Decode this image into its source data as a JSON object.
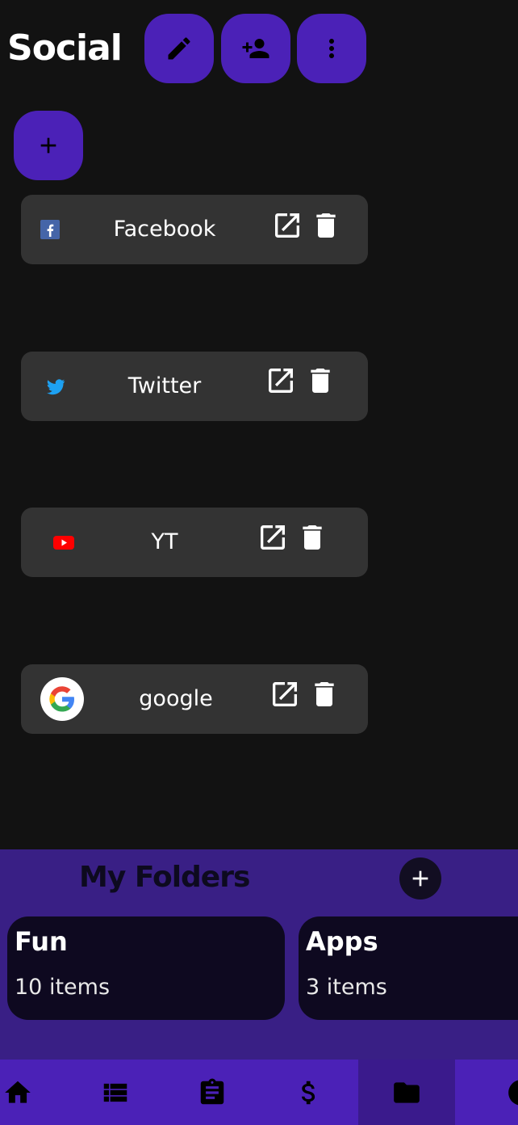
{
  "header": {
    "title": "Social",
    "buttons": [
      {
        "icon": "pencil-icon"
      },
      {
        "icon": "add-person-icon"
      },
      {
        "icon": "more-vert-icon"
      }
    ]
  },
  "add_link_button": {
    "icon": "plus-icon"
  },
  "links": [
    {
      "label": "Facebook",
      "icon": "facebook-icon"
    },
    {
      "label": "Twitter",
      "icon": "twitter-icon"
    },
    {
      "label": "YT",
      "icon": "youtube-icon"
    },
    {
      "label": "google",
      "icon": "google-icon"
    }
  ],
  "link_actions": {
    "open_icon": "open-external-icon",
    "delete_icon": "trash-icon"
  },
  "folders": {
    "title": "My Folders",
    "add_icon": "plus-icon",
    "items": [
      {
        "name": "Fun",
        "count": "10 items"
      },
      {
        "name": "Apps",
        "count": "3 items"
      }
    ]
  },
  "nav": {
    "items": [
      {
        "icon": "home-icon"
      },
      {
        "icon": "list-icon"
      },
      {
        "icon": "clipboard-icon"
      },
      {
        "icon": "dollar-icon"
      },
      {
        "icon": "folder-icon",
        "active": true
      },
      {
        "icon": "contrast-icon"
      }
    ]
  },
  "colors": {
    "background": "#121212",
    "accent": "#4b21b7",
    "card": "#333333",
    "folders_panel": "#391f85",
    "folder_card": "#0e0920"
  }
}
